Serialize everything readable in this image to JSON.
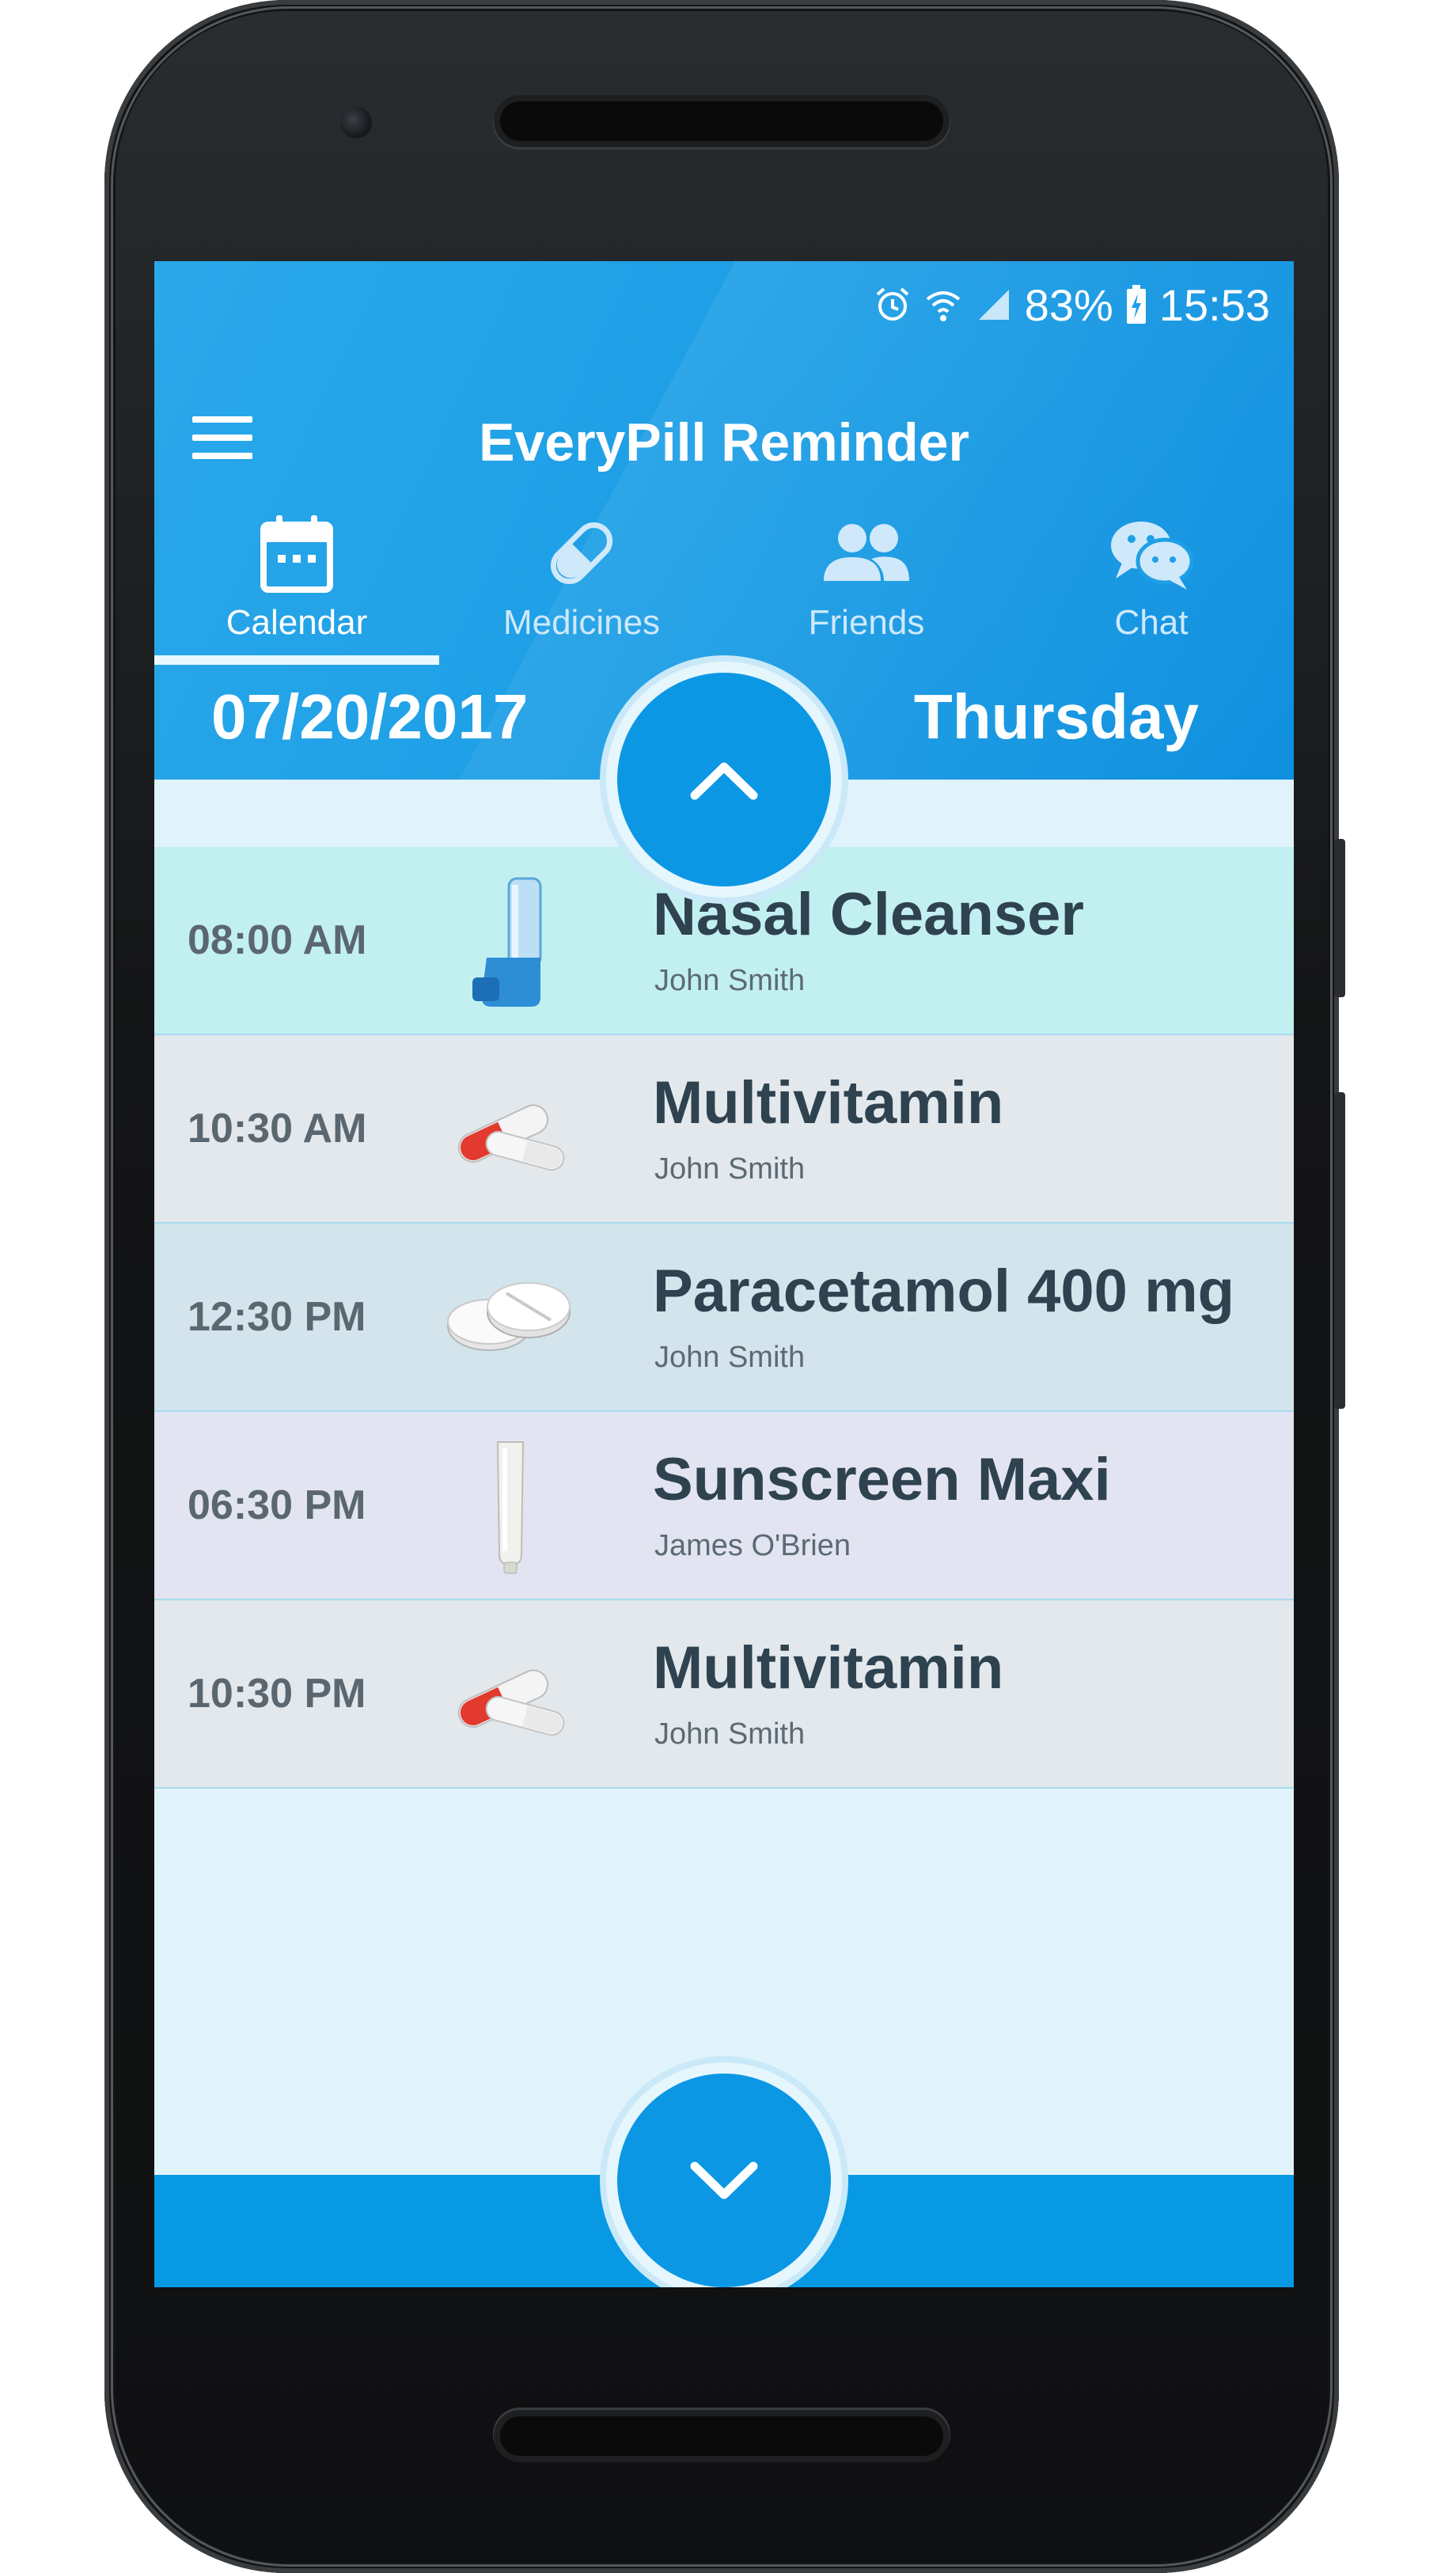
{
  "status_bar": {
    "battery_percent": "83%",
    "time": "15:53",
    "icons": [
      "alarm-icon",
      "wifi-icon",
      "signal-icon",
      "battery-charging-icon"
    ]
  },
  "app": {
    "title": "EveryPill Reminder"
  },
  "tabs": [
    {
      "label": "Calendar",
      "icon": "calendar-icon",
      "active": true
    },
    {
      "label": "Medicines",
      "icon": "pill-icon",
      "active": false
    },
    {
      "label": "Friends",
      "icon": "friends-icon",
      "active": false
    },
    {
      "label": "Chat",
      "icon": "chat-icon",
      "active": false
    }
  ],
  "date_bar": {
    "date": "07/20/2017",
    "weekday": "Thursday"
  },
  "reminders": [
    {
      "time": "08:00 AM",
      "name": "Nasal Cleanser",
      "person": "John Smith",
      "icon": "inhaler-icon",
      "row_color": "#c2f0f0"
    },
    {
      "time": "10:30 AM",
      "name": "Multivitamin",
      "person": "John Smith",
      "icon": "capsules-icon",
      "row_color": "#e2e8ec"
    },
    {
      "time": "12:30 PM",
      "name": "Paracetamol 400 mg",
      "person": "John Smith",
      "icon": "tablets-icon",
      "row_color": "#d3e4ec"
    },
    {
      "time": "06:30 PM",
      "name": "Sunscreen Maxi",
      "person": "James O'Brien",
      "icon": "tube-icon",
      "row_color": "#e2e5f1"
    },
    {
      "time": "10:30 PM",
      "name": "Multivitamin",
      "person": "John Smith",
      "icon": "capsules-icon",
      "row_color": "#e2e8ec"
    }
  ],
  "colors": {
    "primary": "#1e9fe6",
    "accent_bar": "#0799e4",
    "list_background": "#e0f3fb"
  }
}
